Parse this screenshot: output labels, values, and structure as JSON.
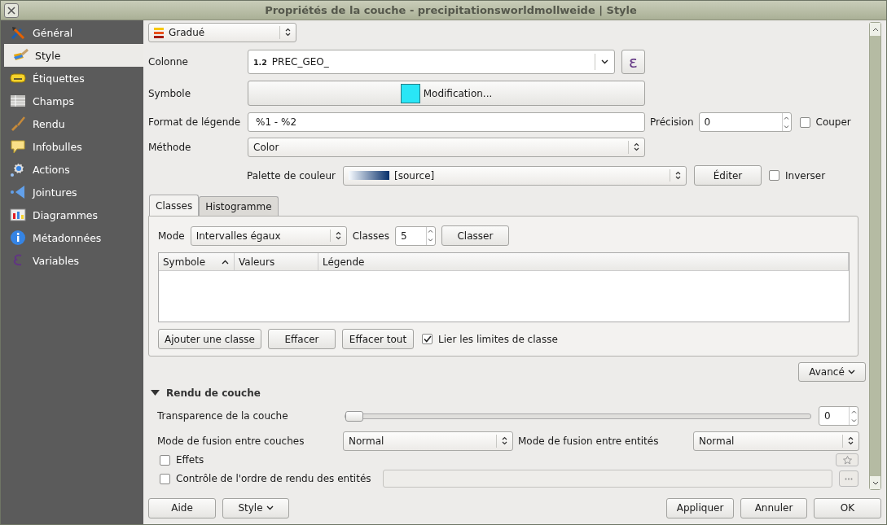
{
  "window": {
    "title": "Propriétés de la couche - precipitationsworldmollweide | Style"
  },
  "sidebar": {
    "items": [
      {
        "label": "Général",
        "selected": false
      },
      {
        "label": "Style",
        "selected": true
      },
      {
        "label": "Étiquettes",
        "selected": false
      },
      {
        "label": "Champs",
        "selected": false
      },
      {
        "label": "Rendu",
        "selected": false
      },
      {
        "label": "Infobulles",
        "selected": false
      },
      {
        "label": "Actions",
        "selected": false
      },
      {
        "label": "Jointures",
        "selected": false
      },
      {
        "label": "Diagrammes",
        "selected": false
      },
      {
        "label": "Métadonnées",
        "selected": false
      },
      {
        "label": "Variables",
        "selected": false
      }
    ]
  },
  "renderer": {
    "value": "Gradué"
  },
  "column": {
    "label": "Colonne",
    "type_badge": "1.2",
    "value": "PREC_GEO_",
    "expression_button": "ε"
  },
  "symbol": {
    "label": "Symbole",
    "button": "Modification..."
  },
  "legend_format": {
    "label": "Format de légende",
    "value": "%1 - %2",
    "precision_label": "Précision",
    "precision": "0",
    "trim": {
      "label": "Couper",
      "checked": false
    }
  },
  "method": {
    "label": "Méthode",
    "value": "Color"
  },
  "color_ramp": {
    "label": "Palette de couleur",
    "value": "[source]",
    "edit_button": "Éditer",
    "invert": {
      "label": "Inverser",
      "checked": false
    }
  },
  "tabs": [
    {
      "label": "Classes",
      "selected": true
    },
    {
      "label": "Histogramme",
      "selected": false
    }
  ],
  "classes": {
    "mode_label": "Mode",
    "mode": "Intervalles égaux",
    "count_label": "Classes",
    "count": "5",
    "classify_button": "Classer",
    "table": {
      "columns": [
        "Symbole",
        "Valeurs",
        "Légende"
      ]
    },
    "buttons": [
      "Ajouter une classe",
      "Effacer",
      "Effacer tout"
    ],
    "link_bounds": {
      "label": "Lier les limites de classe",
      "checked": true
    }
  },
  "advanced_button": "Avancé",
  "layer_rendering": {
    "title": "Rendu de couche",
    "expanded": true,
    "transparency": {
      "label": "Transparence de la couche",
      "level": 0,
      "value": "0"
    },
    "layer_blend": {
      "label": "Mode de fusion entre couches",
      "value": "Normal"
    },
    "feature_blend": {
      "label": "Mode de fusion entre entités",
      "value": "Normal"
    },
    "effects": {
      "label": "Effets",
      "checked": false
    },
    "render_order": {
      "label": "Contrôle de l'ordre de rendu des entités",
      "checked": false
    }
  },
  "footer": {
    "help": "Aide",
    "style": "Style",
    "apply": "Appliquer",
    "cancel": "Annuler",
    "ok": "OK"
  }
}
